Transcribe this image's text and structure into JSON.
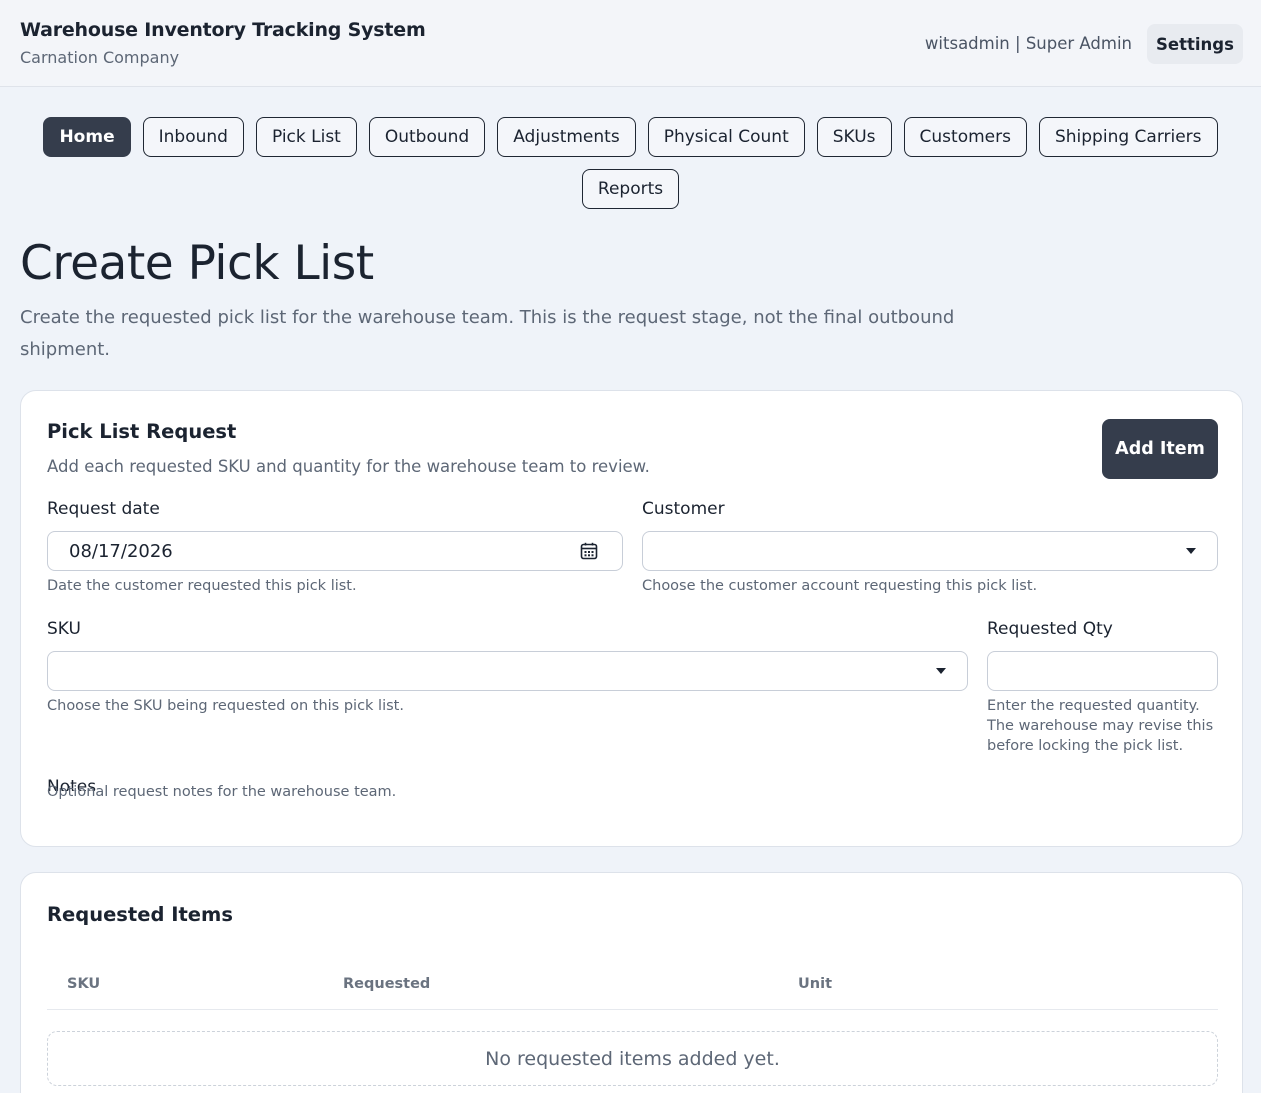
{
  "header": {
    "title": "Warehouse Inventory Tracking System",
    "company": "Carnation Company",
    "user": "witsadmin | Super Admin",
    "settings_label": "Settings"
  },
  "nav": {
    "items": [
      {
        "label": "Home",
        "active": true
      },
      {
        "label": "Inbound"
      },
      {
        "label": "Pick List"
      },
      {
        "label": "Outbound"
      },
      {
        "label": "Adjustments"
      },
      {
        "label": "Physical Count"
      },
      {
        "label": "SKUs"
      },
      {
        "label": "Customers"
      },
      {
        "label": "Shipping Carriers"
      },
      {
        "label": "Reports"
      }
    ]
  },
  "page": {
    "title": "Create Pick List",
    "description": "Create the requested pick list for the warehouse team. This is the request stage, not the final outbound shipment."
  },
  "request_card": {
    "title": "Pick List Request",
    "subtitle": "Add each requested SKU and quantity for the warehouse team to review.",
    "add_item_label": "Add Item",
    "request_date": {
      "label": "Request date",
      "value": "08/17/2026",
      "hint": "Date the customer requested this pick list."
    },
    "customer": {
      "label": "Customer",
      "value": "",
      "hint": "Choose the customer account requesting this pick list."
    },
    "sku": {
      "label": "SKU",
      "value": "",
      "hint": "Choose the SKU being requested on this pick list."
    },
    "requested_qty": {
      "label": "Requested Qty",
      "value": "",
      "hint": "Enter the requested quantity. The warehouse may revise this before locking the pick list."
    },
    "notes": {
      "label": "Notes",
      "hint": "Optional request notes for the warehouse team."
    }
  },
  "items_card": {
    "title": "Requested Items",
    "columns": [
      "SKU",
      "Requested",
      "Unit"
    ],
    "empty_text": "No requested items added yet."
  },
  "colors": {
    "accent_dark": "#353d4c",
    "background": "#eff3f9"
  }
}
